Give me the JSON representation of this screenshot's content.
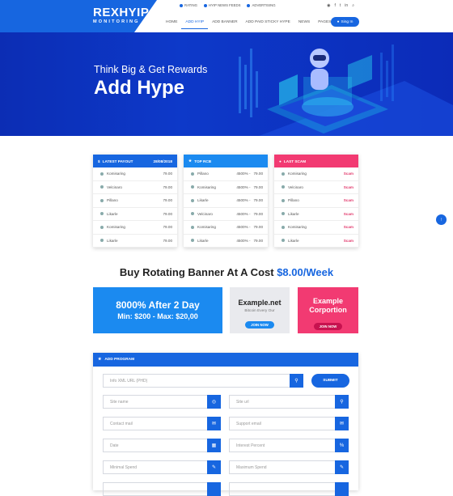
{
  "logo": {
    "title": "REXHYIP",
    "subtitle": "MONITORING"
  },
  "toplinks": [
    "RATING",
    "HYIP NEWS FEEDS",
    "ADVERTISING"
  ],
  "nav": [
    "HOME",
    "ADD HYIP",
    "ADD BANNER",
    "ADD PAID STICKY HYPE",
    "NEWS",
    "PAGES"
  ],
  "signin": "Sing In",
  "hero": {
    "subtitle": "Think Big & Get Rewards",
    "title": "Add Hype"
  },
  "latest": {
    "title": "LATEST PAYOUT",
    "date": "28/08/2018",
    "rows": [
      [
        "Komisaring",
        "79.00"
      ],
      [
        "Velcinaro",
        "79.00"
      ],
      [
        "Pillano",
        "79.00"
      ],
      [
        "Likarle",
        "79.00"
      ],
      [
        "Komisaring",
        "79.00"
      ],
      [
        "Likarle",
        "79.00"
      ]
    ]
  },
  "toprcb": {
    "title": "TOP RCB",
    "rows": [
      [
        "Pillano",
        "4500% -",
        "79.00"
      ],
      [
        "Komisaring",
        "4500% -",
        "79.00"
      ],
      [
        "Likarle",
        "4500% -",
        "79.00"
      ],
      [
        "Velcinaro",
        "4500% -",
        "79.00"
      ],
      [
        "Komisaring",
        "4500% -",
        "79.00"
      ],
      [
        "Likarle",
        "4500% -",
        "79.00"
      ]
    ]
  },
  "scam": {
    "title": "LAST SCAM",
    "label": "Scam",
    "rows": [
      "Komisaring",
      "Velcinaro",
      "Pillano",
      "Likarle",
      "Komisaring",
      "Likarle"
    ]
  },
  "bannerTitle": {
    "text": "Buy Rotating Banner At A Cost",
    "price": "$8.00/Week"
  },
  "banners": {
    "b1": {
      "line1": "8000% After 2 Day",
      "line2": "Min: $200 - Max: $20,00"
    },
    "b2": {
      "title": "Example.net",
      "sub": "Bitcoin Every Our",
      "btn": "JOIN NOW"
    },
    "b3": {
      "title": "Example Corportion",
      "btn": "JOIN NOW"
    }
  },
  "form": {
    "title": "ADD PROGRAM",
    "url": "Info XML URL (PHD)",
    "submit": "SUBMIT",
    "left": [
      "Site name",
      "Contact mail",
      "Date",
      "Minimal Spend"
    ],
    "right": [
      "Site url",
      "Support email",
      "Interest Percent",
      "Maximum Spend"
    ]
  }
}
